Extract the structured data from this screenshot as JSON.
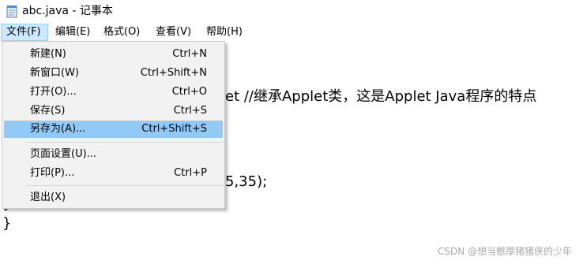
{
  "window": {
    "title": "abc.java - 记事本",
    "icon": "notepad-icon"
  },
  "menubar": {
    "items": [
      {
        "label": "文件(F)",
        "active": true
      },
      {
        "label": "编辑(E)",
        "active": false
      },
      {
        "label": "格式(O)",
        "active": false
      },
      {
        "label": "查看(V)",
        "active": false
      },
      {
        "label": "帮助(H)",
        "active": false
      }
    ]
  },
  "file_menu": {
    "items": [
      {
        "label": "新建(N)",
        "shortcut": "Ctrl+N"
      },
      {
        "label": "新窗口(W)",
        "shortcut": "Ctrl+Shift+N"
      },
      {
        "label": "打开(O)...",
        "shortcut": "Ctrl+O"
      },
      {
        "label": "保存(S)",
        "shortcut": "Ctrl+S"
      },
      {
        "label": "另存为(A)...",
        "shortcut": "Ctrl+Shift+S",
        "highlighted": true
      },
      {
        "label": "页面设置(U)...",
        "shortcut": ""
      },
      {
        "label": "打印(P)...",
        "shortcut": "Ctrl+P"
      },
      {
        "label": "退出(X)",
        "shortcut": ""
      }
    ]
  },
  "editor": {
    "visible_lines": [
      "et //继承Applet类，这是Applet Java程序的特点",
      "5,35);",
      "}",
      "}"
    ]
  },
  "watermark": {
    "text": "CSDN @想当憨厚猪猪侠的少年"
  },
  "colors": {
    "menu_highlight": "#91c9f7",
    "menubar_active": "#cce8ff",
    "dropdown_bg": "#f2f2f2"
  }
}
